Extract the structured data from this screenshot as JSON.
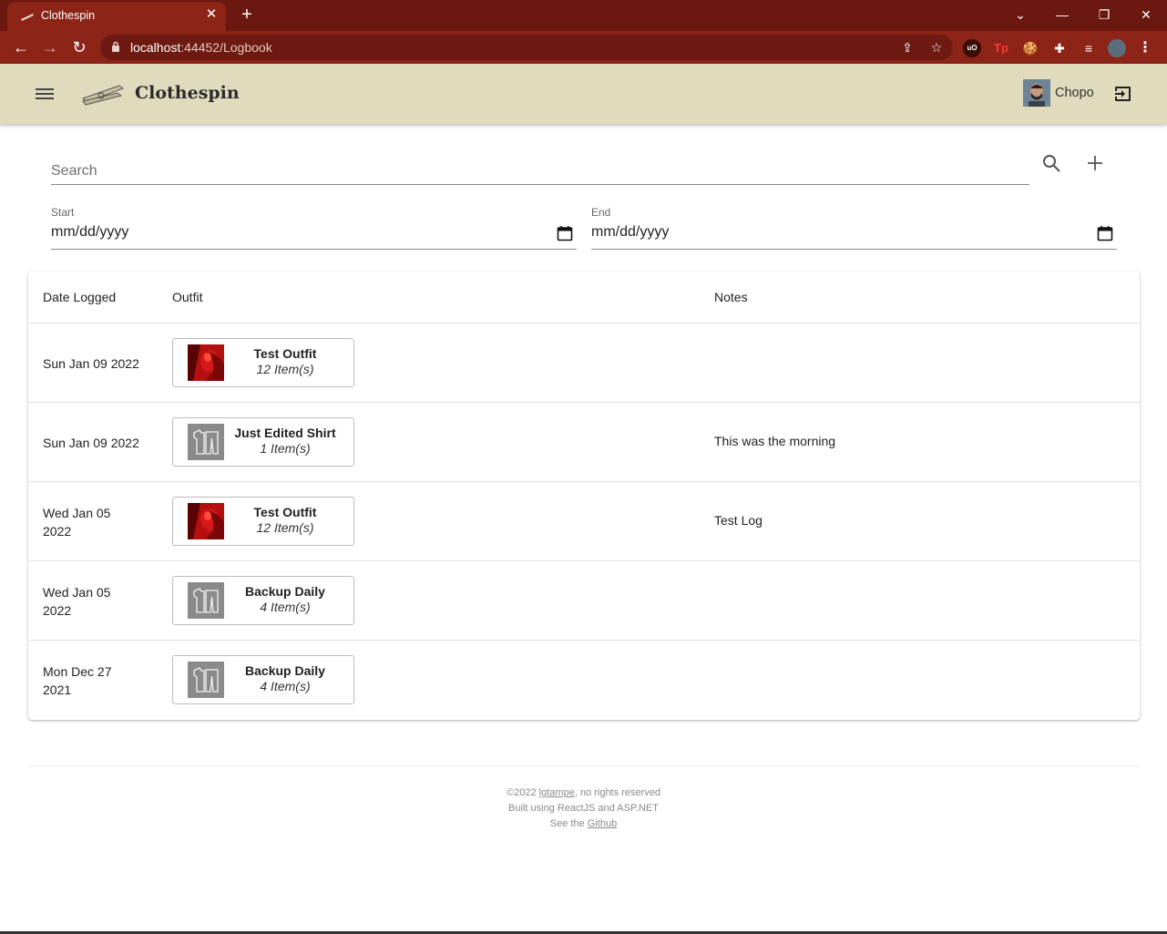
{
  "browser": {
    "tab_title": "Clothespin",
    "tab_close": "✕",
    "new_tab": "+",
    "url_host": "localhost",
    "url_path": ":44452/Logbook",
    "extensions": {
      "ublock": "uO",
      "tp": "Tp"
    }
  },
  "appbar": {
    "brand": "Clothespin",
    "username": "Chopo"
  },
  "filters": {
    "search_placeholder": "Search",
    "start_label": "Start",
    "start_value": "mm/dd/yyyy",
    "end_label": "End",
    "end_value": "mm/dd/yyyy"
  },
  "table": {
    "headers": {
      "date": "Date Logged",
      "outfit": "Outfit",
      "notes": "Notes"
    },
    "rows": [
      {
        "date_line1": "Sun Jan 09 2022",
        "date_line2": "",
        "outfit_name": "Test Outfit",
        "outfit_count": "12 Item(s)",
        "thumb": "red-photo",
        "notes": ""
      },
      {
        "date_line1": "Sun Jan 09 2022",
        "date_line2": "",
        "outfit_name": "Just Edited Shirt",
        "outfit_count": "1 Item(s)",
        "thumb": "clothes-placeholder",
        "notes": "This was the morning"
      },
      {
        "date_line1": "Wed Jan 05",
        "date_line2": "2022",
        "outfit_name": "Test Outfit",
        "outfit_count": "12 Item(s)",
        "thumb": "red-photo",
        "notes": "Test Log"
      },
      {
        "date_line1": "Wed Jan 05",
        "date_line2": "2022",
        "outfit_name": "Backup Daily",
        "outfit_count": "4 Item(s)",
        "thumb": "clothes-placeholder",
        "notes": ""
      },
      {
        "date_line1": "Mon Dec 27",
        "date_line2": "2021",
        "outfit_name": "Backup Daily",
        "outfit_count": "4 Item(s)",
        "thumb": "clothes-placeholder",
        "notes": ""
      }
    ]
  },
  "footer": {
    "line1_prefix": "©2022 ",
    "line1_link": "lgtampe",
    "line1_suffix": ", no rights reserved",
    "line2": "Built using ReactJS and ASP.NET",
    "line3_prefix": "See the ",
    "line3_link": "Github"
  },
  "colors": {
    "browser_frame": "#6b1810",
    "appbar_bg": "#e0dbbc",
    "thumb_red": "#b3100f",
    "thumb_gray": "#8a8a8a"
  }
}
